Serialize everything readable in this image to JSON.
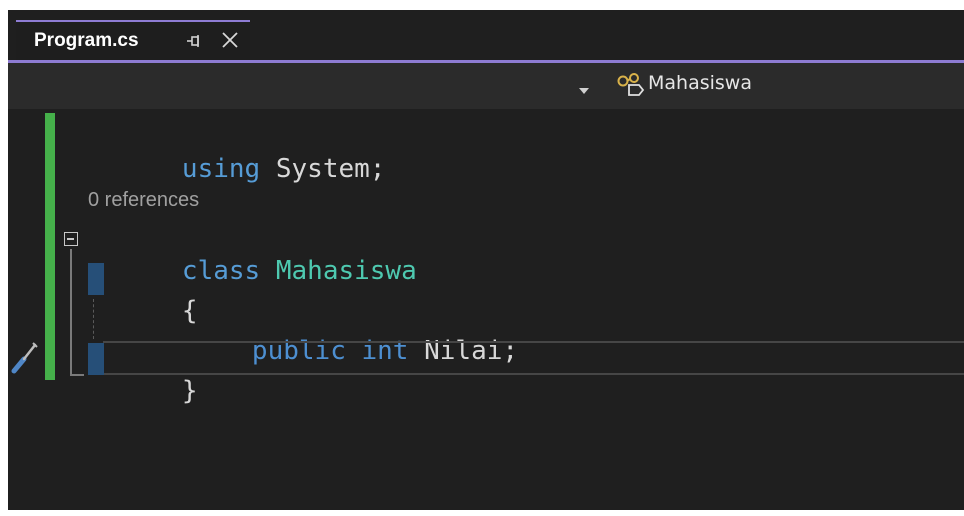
{
  "tab": {
    "title": "Program.cs",
    "pin_icon": "pin-icon",
    "close_icon": "close-icon"
  },
  "navbar": {
    "dropdown_icon": "chevron-down-icon",
    "class_icon": "class-icon",
    "class_label": "Mahasiswa"
  },
  "editor": {
    "line1": {
      "keyword": "using",
      "rest": " System;"
    },
    "codelens": "0 references",
    "line3": {
      "keyword": "class",
      "type": "Mahasiswa"
    },
    "open_brace": "{",
    "line5": {
      "keyword1": "public",
      "keyword2": "int",
      "identifier": "Nilai;"
    },
    "close_brace": "}",
    "quick_action_icon": "screwdriver-icon"
  },
  "colors": {
    "accent": "#8e7cd3",
    "change_bar": "#45b04a",
    "keyword": "#569cd6",
    "type": "#4ec9b0",
    "background": "#1f1f1f"
  }
}
